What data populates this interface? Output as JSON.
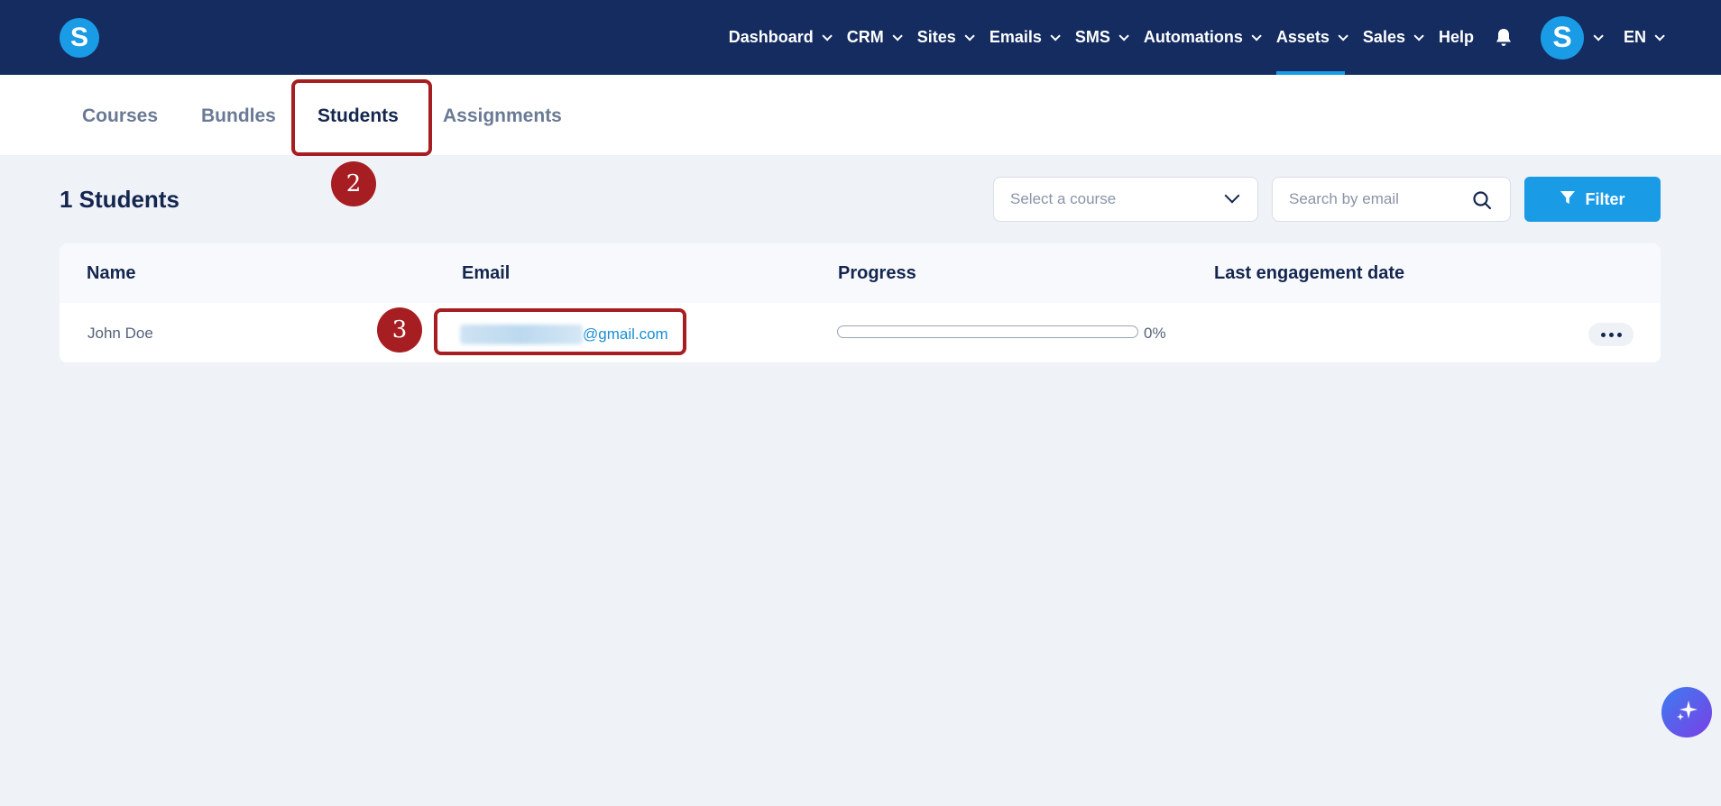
{
  "nav": {
    "items": [
      {
        "label": "Dashboard",
        "dropdown": true
      },
      {
        "label": "CRM",
        "dropdown": true
      },
      {
        "label": "Sites",
        "dropdown": true
      },
      {
        "label": "Emails",
        "dropdown": true
      },
      {
        "label": "SMS",
        "dropdown": true
      },
      {
        "label": "Automations",
        "dropdown": true
      },
      {
        "label": "Assets",
        "dropdown": true,
        "active": true
      },
      {
        "label": "Sales",
        "dropdown": true
      },
      {
        "label": "Help",
        "dropdown": false
      }
    ],
    "logo_letter": "S",
    "avatar_letter": "S",
    "language": "EN"
  },
  "tabs": [
    "Courses",
    "Bundles",
    "Students",
    "Assignments"
  ],
  "active_tab": "Students",
  "page": {
    "count_title": "1 Students",
    "course_select_placeholder": "Select a course",
    "search_placeholder": "Search by email",
    "filter_label": "Filter"
  },
  "table": {
    "headers": [
      "Name",
      "Email",
      "Progress",
      "Last engagement date"
    ],
    "rows": [
      {
        "name": "John Doe",
        "email_domain": "@gmail.com",
        "progress": "0%",
        "progress_value": 0,
        "last_engagement": ""
      }
    ]
  },
  "annotations": {
    "step_2": "2",
    "step_3": "3"
  },
  "colors": {
    "navbar": "#152c61",
    "accent": "#1a9be6",
    "annotation": "#a71e22"
  }
}
